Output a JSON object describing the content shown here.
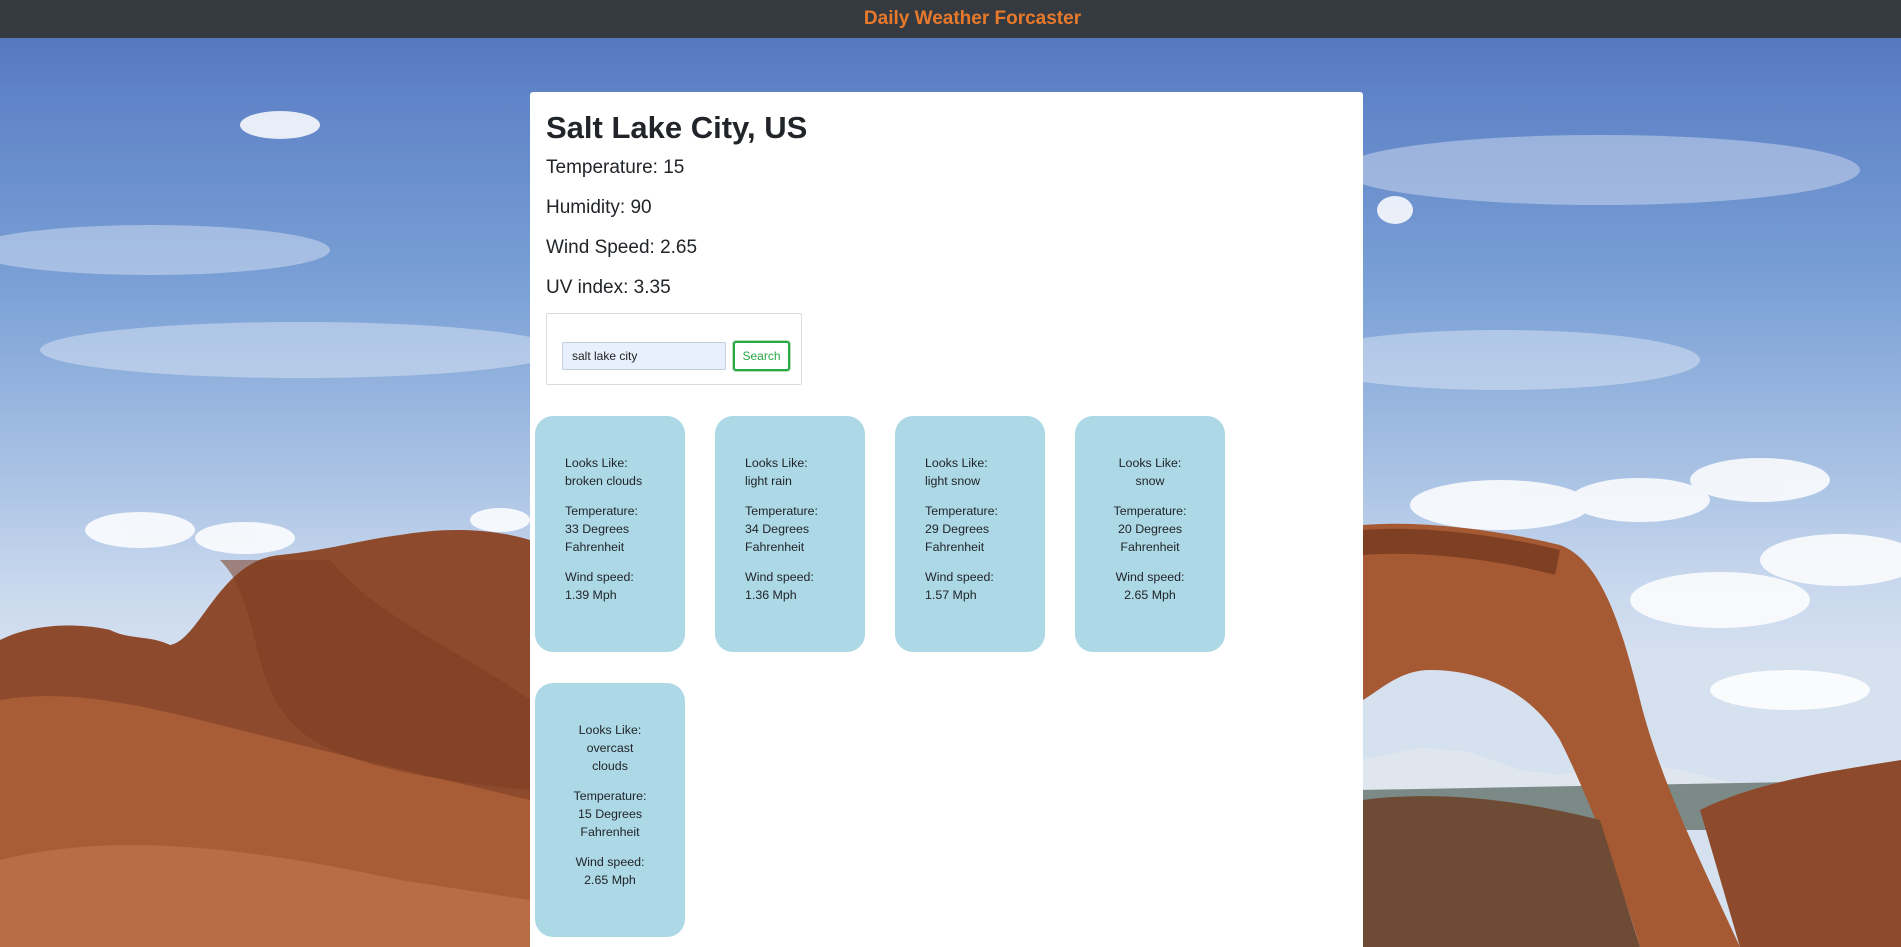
{
  "app": {
    "title": "Daily Weather Forcaster"
  },
  "current": {
    "city": "Salt Lake City, US",
    "temperature": "Temperature: 15",
    "humidity": "Humidity: 90",
    "wind_speed": "Wind Speed: 2.65",
    "uv_index": "UV index: 3.35"
  },
  "search": {
    "value": "salt lake city",
    "button_label": "Search"
  },
  "forecast": [
    {
      "looks_like_label": "Looks Like:",
      "looks_like": "broken clouds",
      "temp_label": "Temperature:",
      "temp": "33 Degrees Fahrenheit",
      "wind_label": "Wind speed:",
      "wind": "1.39 Mph"
    },
    {
      "looks_like_label": "Looks Like:",
      "looks_like": "light rain",
      "temp_label": "Temperature:",
      "temp": "34 Degrees Fahrenheit",
      "wind_label": "Wind speed:",
      "wind": "1.36 Mph"
    },
    {
      "looks_like_label": "Looks Like:",
      "looks_like": "light snow",
      "temp_label": "Temperature:",
      "temp": "29 Degrees Fahrenheit",
      "wind_label": "Wind speed:",
      "wind": "1.57 Mph"
    },
    {
      "looks_like_label": "Looks Like:",
      "looks_like": "snow",
      "temp_label": "Temperature:",
      "temp": "20 Degrees Fahrenheit",
      "wind_label": "Wind speed:",
      "wind": "2.65 Mph"
    },
    {
      "looks_like_label": "Looks Like:",
      "looks_like": "overcast clouds",
      "temp_label": "Temperature:",
      "temp": "15 Degrees Fahrenheit",
      "wind_label": "Wind speed:",
      "wind": "2.65 Mph"
    }
  ],
  "colors": {
    "navbar": "#343a40",
    "title": "#e8792b",
    "card": "#add8e6",
    "search_button": "#28a745"
  }
}
